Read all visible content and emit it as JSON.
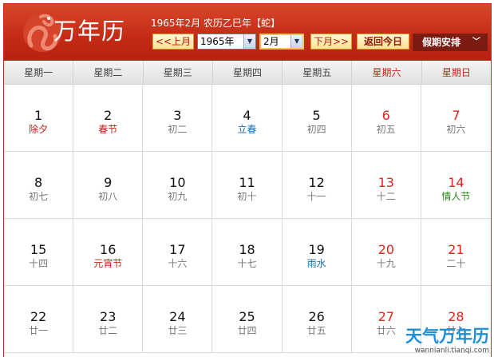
{
  "header": {
    "logo_icon": "snake-zodiac-icon",
    "title": "万年历",
    "lunar_info": "1965年2月 农历乙巳年【蛇】",
    "prev_month_label": "<<上月",
    "year_select": "1965年",
    "month_select": "2月",
    "next_month_label": "下月>>",
    "today_label": "返回今日",
    "holiday_label": "假期安排",
    "holiday_chevron": "﹀"
  },
  "weekdays": [
    "星期一",
    "星期二",
    "星期三",
    "星期四",
    "星期五",
    "星期六",
    "星期日"
  ],
  "days": [
    {
      "day": "1",
      "sub": "除夕"
    },
    {
      "day": "2",
      "sub": "春节"
    },
    {
      "day": "3",
      "sub": "初二"
    },
    {
      "day": "4",
      "sub": "立春"
    },
    {
      "day": "5",
      "sub": "初四"
    },
    {
      "day": "6",
      "sub": "初五"
    },
    {
      "day": "7",
      "sub": "初六"
    },
    {
      "day": "8",
      "sub": "初七"
    },
    {
      "day": "9",
      "sub": "初八"
    },
    {
      "day": "10",
      "sub": "初九"
    },
    {
      "day": "11",
      "sub": "初十"
    },
    {
      "day": "12",
      "sub": "十一"
    },
    {
      "day": "13",
      "sub": "十二"
    },
    {
      "day": "14",
      "sub": "情人节"
    },
    {
      "day": "15",
      "sub": "十四"
    },
    {
      "day": "16",
      "sub": "元宵节"
    },
    {
      "day": "17",
      "sub": "十六"
    },
    {
      "day": "18",
      "sub": "十七"
    },
    {
      "day": "19",
      "sub": "雨水"
    },
    {
      "day": "20",
      "sub": "十九"
    },
    {
      "day": "21",
      "sub": "二十"
    },
    {
      "day": "22",
      "sub": "廿一"
    },
    {
      "day": "23",
      "sub": "廿二"
    },
    {
      "day": "24",
      "sub": "廿三"
    },
    {
      "day": "25",
      "sub": "廿四"
    },
    {
      "day": "26",
      "sub": "廿五"
    },
    {
      "day": "27",
      "sub": "廿六"
    },
    {
      "day": "28",
      "sub": "廿七"
    }
  ],
  "watermark": {
    "brand": "天气万年历",
    "url": "wannianli.tianqi.com"
  },
  "colors": {
    "header_red": "#c52c16",
    "weekend_red": "#e6231a",
    "festival_red": "#c2231a",
    "solar_term_blue": "#1a6ea8",
    "festival_green": "#2a8a1a",
    "holiday_button": "#7a1c12"
  }
}
